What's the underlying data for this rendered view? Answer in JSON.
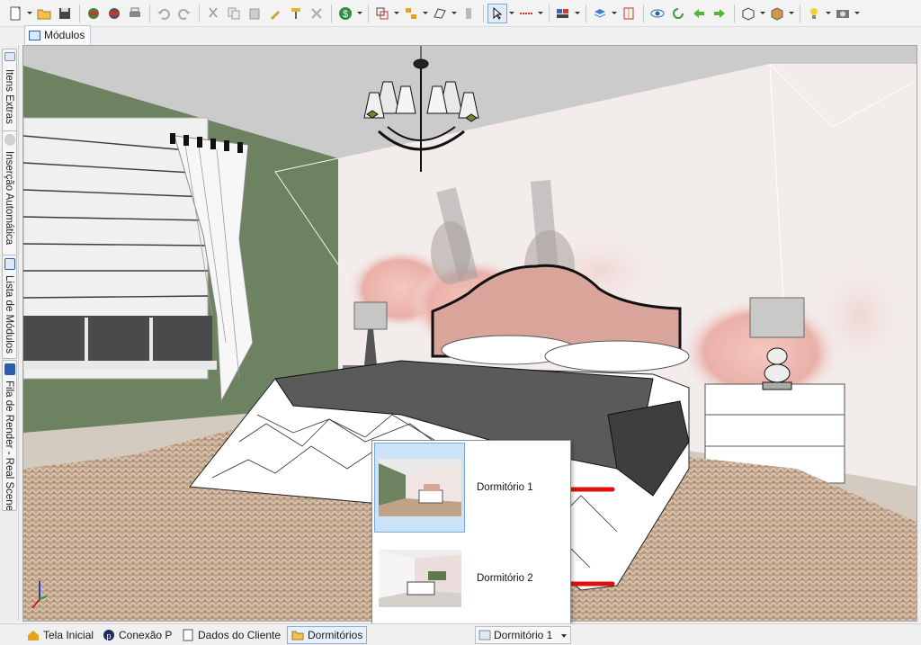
{
  "toolbar": {
    "icons": [
      "new-icon",
      "open-folder-icon",
      "save-icon",
      "render-icon",
      "render-alt-icon",
      "print-icon",
      "undo-icon",
      "redo-icon",
      "cut-icon",
      "copy-icon",
      "paste-icon",
      "paint-brush-icon",
      "roller-icon",
      "delete-icon",
      "money-icon",
      "layers-icon",
      "align-icon",
      "shape-icon",
      "panel-icon",
      "select-cursor-icon",
      "measure-icon",
      "color-icon",
      "stack-icon",
      "mirror-icon",
      "eye-icon",
      "rotate-left-icon",
      "arrow-left-icon",
      "arrow-right-icon",
      "cube-view-icon",
      "box-icon",
      "light-icon",
      "camera-icon"
    ]
  },
  "doc_tab": {
    "label": "Módulos"
  },
  "side_tabs": [
    {
      "label": "Itens Extras"
    },
    {
      "label": "Inserção Automática"
    },
    {
      "label": "Lista de Módulos"
    },
    {
      "label": "Fila de Render - Real Scene"
    }
  ],
  "popup": {
    "items": [
      {
        "label": "Dormitório 1",
        "selected": true
      },
      {
        "label": "Dormitório 2",
        "selected": false
      }
    ]
  },
  "statusbar": {
    "tabs": [
      {
        "label": "Tela Inicial"
      },
      {
        "label": "Conexão P"
      },
      {
        "label": "Dados do Cliente"
      },
      {
        "label": "Dormitórios"
      }
    ],
    "combo_value": "Dormitório 1"
  },
  "colors": {
    "accent": "#3b7fd6",
    "wall_green": "#6d8261",
    "headboard": "#d9a49a",
    "arrow_red": "#e01010"
  }
}
